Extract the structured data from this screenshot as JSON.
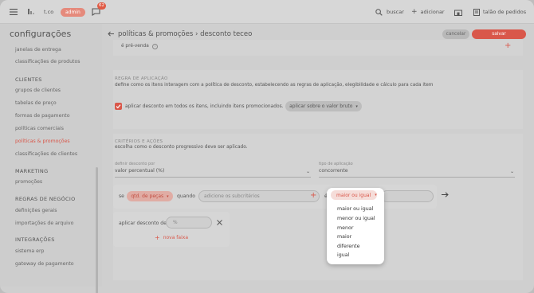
{
  "topbar": {
    "shop": "t.co",
    "role_badge": "admin",
    "notifications_count": "62",
    "search_label": "buscar",
    "add_label": "adicionar",
    "orders_label": "talão de pedidos"
  },
  "sidebar": {
    "title": "configurações",
    "top_items": [
      "janelas de entrega",
      "classificações de produtos"
    ],
    "sections": [
      {
        "title": "CLIENTES",
        "items": [
          "grupos de clientes",
          "tabelas de preço",
          "formas de pagamento",
          "políticas comerciais",
          "políticas & promoções",
          "classificações de clientes"
        ]
      },
      {
        "title": "MARKETING",
        "items": [
          "promoções"
        ]
      },
      {
        "title": "REGRAS DE NEGÓCIO",
        "items": [
          "definições gerais",
          "importações de arquivo"
        ]
      },
      {
        "title": "INTEGRAÇÕES",
        "items": [
          "sistema erp",
          "gateway de pagamento"
        ]
      }
    ],
    "active_item": "políticas & promoções"
  },
  "header": {
    "breadcrumb": "políticas & promoções  ›  desconto teceo",
    "cancel_label": "cancelar",
    "save_label": "salvar"
  },
  "presale": {
    "label": "é pré-venda"
  },
  "rule": {
    "section_title": "REGRA DE APLICAÇÃO",
    "description": "define como os itens interagem com a política de desconto, estabelecendo as regras de aplicação, elegibilidade e cálculo para cada item",
    "checkbox_label": "aplicar desconto em todos os itens, incluindo itens promocionados.",
    "checkbox_checked": true,
    "apply_select": "aplicar sobre o valor bruto"
  },
  "criteria": {
    "section_title": "CRITÉRIOS E AÇÕES",
    "description": "escolha como o desconto progressivo deve ser aplicado.",
    "discount_field_label": "definir desconto por",
    "discount_field_value": "valor percentual (%)",
    "apply_type_label": "tipo de aplicação",
    "apply_type_value": "concorrente",
    "if_label": "se",
    "qty_pill": "qtd. de peças",
    "when_label": "quando",
    "subcriteria_placeholder": "adicione os subcritérios",
    "is_label": "é",
    "operator_selected": "maior ou igual",
    "apply_discount_label": "aplicar desconto de",
    "percent_placeholder": "%",
    "new_range_label": "nova faixa"
  },
  "operator_dropdown": {
    "options": [
      "maior ou igual",
      "menor ou igual",
      "menor",
      "maior",
      "diferente",
      "igual"
    ]
  },
  "colors": {
    "accent": "#d9574a",
    "background": "#cfcfcf"
  }
}
